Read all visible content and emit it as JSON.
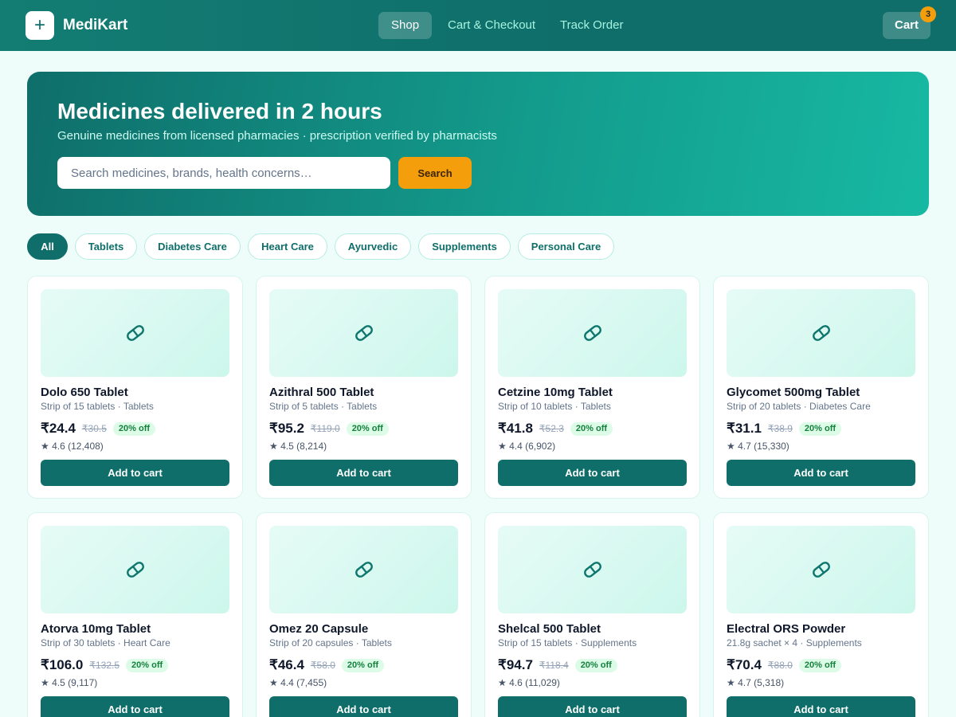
{
  "header": {
    "logo_symbol": "+",
    "brand": "MediKart",
    "nav": [
      {
        "label": "Shop",
        "active": true
      },
      {
        "label": "Cart & Checkout",
        "active": false
      },
      {
        "label": "Track Order",
        "active": false
      }
    ],
    "cart_label": "Cart",
    "cart_count": "3"
  },
  "hero": {
    "title": "Medicines delivered in 2 hours",
    "subtitle": "Genuine medicines from licensed pharmacies · prescription verified by pharmacists",
    "search_placeholder": "Search medicines, brands, health concerns…",
    "search_button": "Search"
  },
  "categories": [
    {
      "label": "All",
      "active": true
    },
    {
      "label": "Tablets",
      "active": false
    },
    {
      "label": "Diabetes Care",
      "active": false
    },
    {
      "label": "Heart Care",
      "active": false
    },
    {
      "label": "Ayurvedic",
      "active": false
    },
    {
      "label": "Supplements",
      "active": false
    },
    {
      "label": "Personal Care",
      "active": false
    }
  ],
  "products": [
    {
      "name": "Dolo 650 Tablet",
      "subtitle": "Strip of 15 tablets · Tablets",
      "price": "₹24.4",
      "mrp": "₹30.5",
      "discount": "20% off",
      "rating": "★ 4.6 (12,408)",
      "button": "Add to cart",
      "icon": "pill-icon"
    },
    {
      "name": "Azithral 500 Tablet",
      "subtitle": "Strip of 5 tablets · Tablets",
      "price": "₹95.2",
      "mrp": "₹119.0",
      "discount": "20% off",
      "rating": "★ 4.5 (8,214)",
      "button": "Add to cart",
      "icon": "pill-icon"
    },
    {
      "name": "Cetzine 10mg Tablet",
      "subtitle": "Strip of 10 tablets · Tablets",
      "price": "₹41.8",
      "mrp": "₹52.3",
      "discount": "20% off",
      "rating": "★ 4.4 (6,902)",
      "button": "Add to cart",
      "icon": "pill-icon"
    },
    {
      "name": "Glycomet 500mg Tablet",
      "subtitle": "Strip of 20 tablets · Diabetes Care",
      "price": "₹31.1",
      "mrp": "₹38.9",
      "discount": "20% off",
      "rating": "★ 4.7 (15,330)",
      "button": "Add to cart",
      "icon": "pill-icon"
    },
    {
      "name": "Atorva 10mg Tablet",
      "subtitle": "Strip of 30 tablets · Heart Care",
      "price": "₹106.0",
      "mrp": "₹132.5",
      "discount": "20% off",
      "rating": "★ 4.5 (9,117)",
      "button": "Add to cart",
      "icon": "pill-icon"
    },
    {
      "name": "Omez 20 Capsule",
      "subtitle": "Strip of 20 capsules · Tablets",
      "price": "₹46.4",
      "mrp": "₹58.0",
      "discount": "20% off",
      "rating": "★ 4.4 (7,455)",
      "button": "Add to cart",
      "icon": "pill-icon"
    },
    {
      "name": "Shelcal 500 Tablet",
      "subtitle": "Strip of 15 tablets · Supplements",
      "price": "₹94.7",
      "mrp": "₹118.4",
      "discount": "20% off",
      "rating": "★ 4.6 (11,029)",
      "button": "Add to cart",
      "icon": "pill-icon"
    },
    {
      "name": "Electral ORS Powder",
      "subtitle": "21.8g sachet × 4 · Supplements",
      "price": "₹70.4",
      "mrp": "₹88.0",
      "discount": "20% off",
      "rating": "★ 4.7 (5,318)",
      "button": "Add to cart",
      "icon": "pill-icon"
    }
  ],
  "colors": {
    "primary": "#0f6e6a",
    "accent": "#f59e0b",
    "page_background": "#effdfa",
    "discount_text": "#15803d",
    "discount_background": "#dcfce7"
  }
}
